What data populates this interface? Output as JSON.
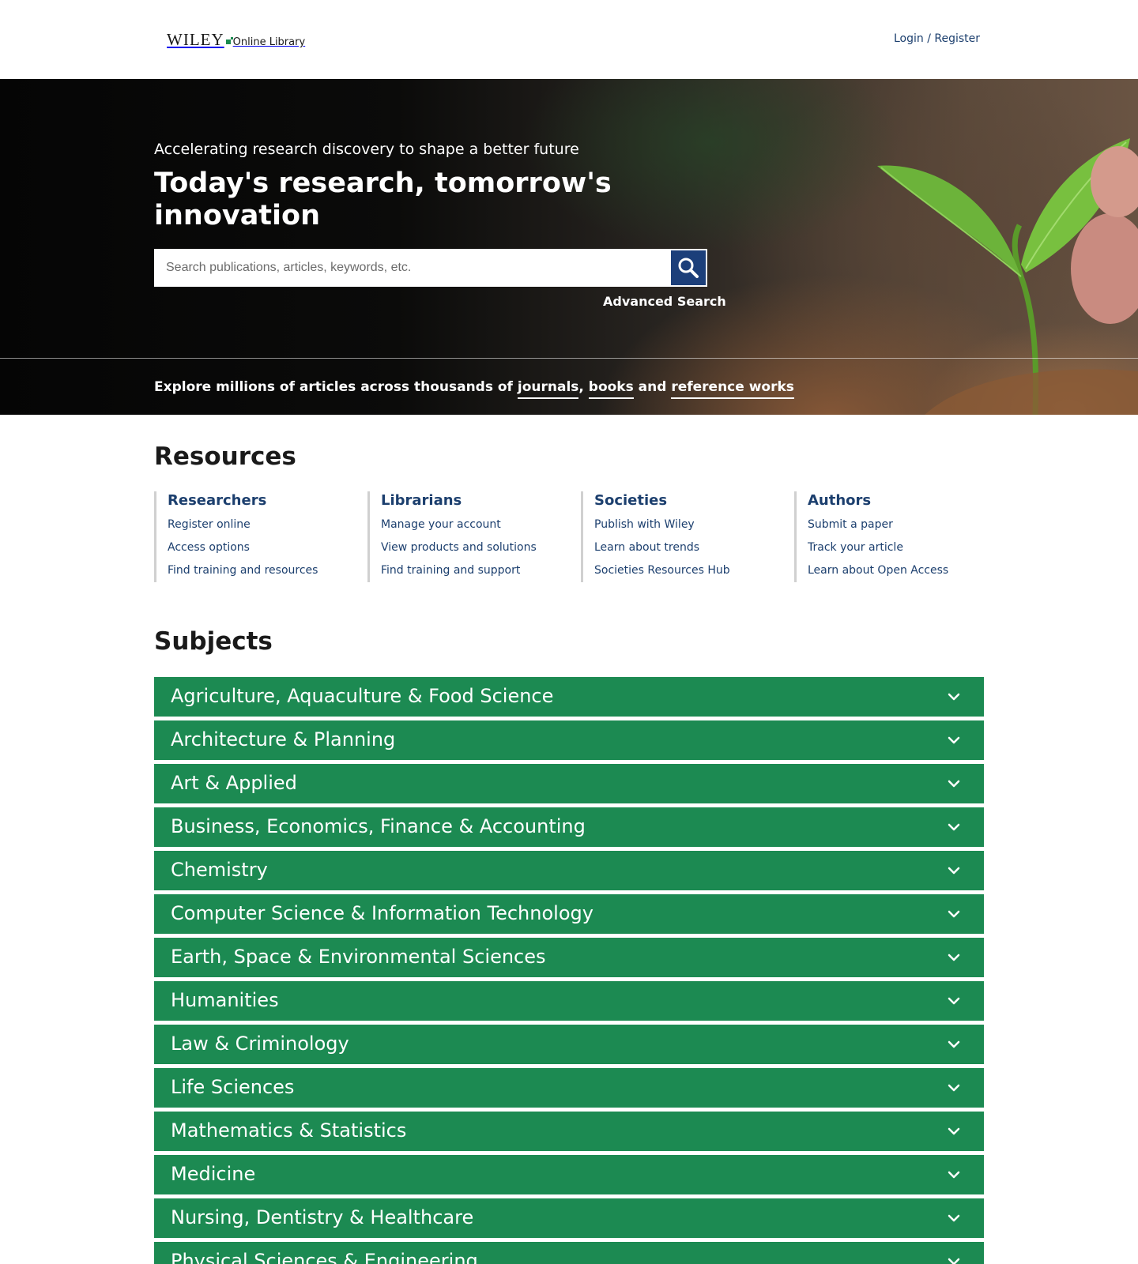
{
  "header": {
    "logo_wiley": "WILEY",
    "logo_online_library": "Online Library",
    "login_label": "Login / Register"
  },
  "hero": {
    "tagline": "Accelerating research discovery to shape a better future",
    "title": "Today's research, tomorrow's innovation",
    "search_placeholder": "Search publications, articles, keywords, etc.",
    "search_icon": "search-icon",
    "advanced_search_label": "Advanced Search",
    "explore_prefix": "Explore millions of articles across thousands of ",
    "explore_link_journals": "journals",
    "explore_sep1": ", ",
    "explore_link_books": "books",
    "explore_sep2": " and ",
    "explore_link_reference": "reference works"
  },
  "resources": {
    "title": "Resources",
    "columns": [
      {
        "heading": "Researchers",
        "links": [
          "Register online",
          "Access options",
          "Find training and resources"
        ]
      },
      {
        "heading": "Librarians",
        "links": [
          "Manage your account",
          "View products and solutions",
          "Find training and support"
        ]
      },
      {
        "heading": "Societies",
        "links": [
          "Publish with Wiley",
          "Learn about trends",
          "Societies Resources Hub"
        ]
      },
      {
        "heading": "Authors",
        "links": [
          "Submit a paper",
          "Track your article",
          "Learn about Open Access"
        ]
      }
    ]
  },
  "subjects": {
    "title": "Subjects",
    "items": [
      "Agriculture, Aquaculture & Food Science",
      "Architecture & Planning",
      "Art & Applied",
      "Business, Economics, Finance & Accounting",
      "Chemistry",
      "Computer Science & Information Technology",
      "Earth, Space & Environmental Sciences",
      "Humanities",
      "Law & Criminology",
      "Life Sciences",
      "Mathematics & Statistics",
      "Medicine",
      "Nursing, Dentistry & Healthcare",
      "Physical Sciences & Engineering"
    ],
    "chevron_icon": "chevron-down-icon"
  },
  "colors": {
    "subject_bg": "#1c8a52",
    "link_blue": "#1c3f6e",
    "search_button": "#1c3f7a"
  }
}
